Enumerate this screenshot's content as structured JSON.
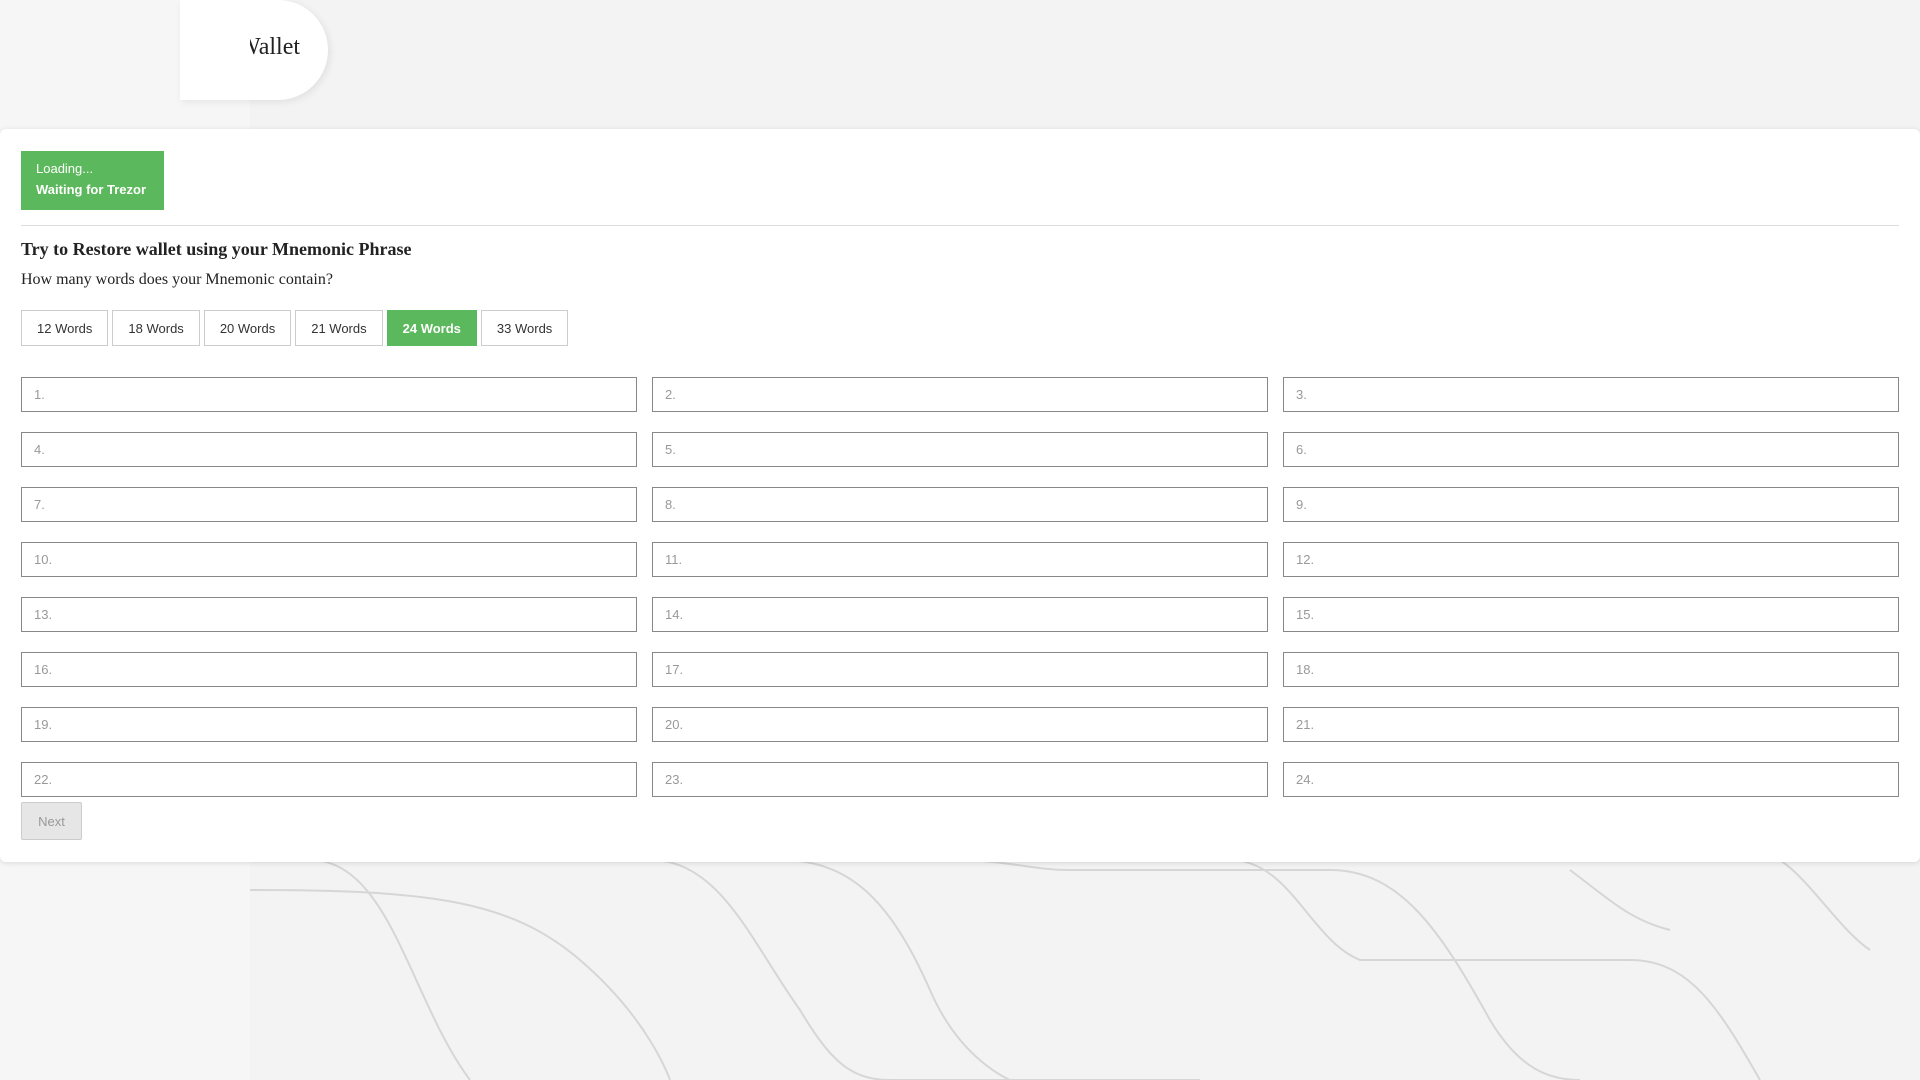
{
  "header": {
    "title": "Wallet"
  },
  "status": {
    "line1": "Loading...",
    "line2": "Waiting for Trezor"
  },
  "restore": {
    "title": "Try to Restore wallet using your Mnemonic Phrase",
    "question": "How many words does your Mnemonic contain?",
    "word_options": [
      "12 Words",
      "18 Words",
      "20 Words",
      "21 Words",
      "24 Words",
      "33 Words"
    ],
    "selected_option": "24 Words",
    "inputs": [
      {
        "placeholder": "1.",
        "value": ""
      },
      {
        "placeholder": "2.",
        "value": ""
      },
      {
        "placeholder": "3.",
        "value": ""
      },
      {
        "placeholder": "4.",
        "value": ""
      },
      {
        "placeholder": "5.",
        "value": ""
      },
      {
        "placeholder": "6.",
        "value": ""
      },
      {
        "placeholder": "7.",
        "value": ""
      },
      {
        "placeholder": "8.",
        "value": ""
      },
      {
        "placeholder": "9.",
        "value": ""
      },
      {
        "placeholder": "10.",
        "value": ""
      },
      {
        "placeholder": "11.",
        "value": ""
      },
      {
        "placeholder": "12.",
        "value": ""
      },
      {
        "placeholder": "13.",
        "value": ""
      },
      {
        "placeholder": "14.",
        "value": ""
      },
      {
        "placeholder": "15.",
        "value": ""
      },
      {
        "placeholder": "16.",
        "value": ""
      },
      {
        "placeholder": "17.",
        "value": ""
      },
      {
        "placeholder": "18.",
        "value": ""
      },
      {
        "placeholder": "19.",
        "value": ""
      },
      {
        "placeholder": "20.",
        "value": ""
      },
      {
        "placeholder": "21.",
        "value": ""
      },
      {
        "placeholder": "22.",
        "value": ""
      },
      {
        "placeholder": "23.",
        "value": ""
      },
      {
        "placeholder": "24.",
        "value": ""
      }
    ],
    "next_label": "Next"
  },
  "colors": {
    "accent": "#5cb85c",
    "card_bg": "#ffffff",
    "page_bg": "#f3f3f3"
  },
  "icons": {
    "watermark": "trezor-logo-icon"
  }
}
